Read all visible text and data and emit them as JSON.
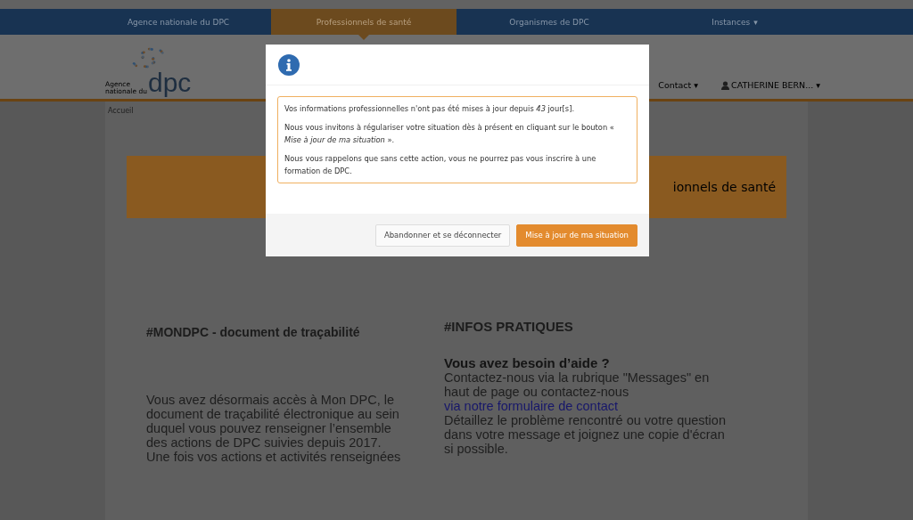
{
  "top_nav": {
    "items": [
      {
        "label": "Agence nationale du DPC",
        "selected": false
      },
      {
        "label": "Professionnels de santé",
        "selected": true
      },
      {
        "label": "Organismes de DPC",
        "selected": false
      },
      {
        "label": "Instances",
        "selected": false,
        "caret": "▾"
      }
    ]
  },
  "header": {
    "logo": {
      "subtitle": "Agence nationale du",
      "wordmark": "dpc"
    },
    "contact": "Contact",
    "contact_caret": "▾",
    "user": "CATHERINE BERN...",
    "user_caret": "▾"
  },
  "breadcrumb": "Accueil",
  "banner": {
    "text": "ionnels de santé"
  },
  "left_column": {
    "heading": "#MONDPC - document de traçabilité",
    "paragraph": "Vous avez désormais accès à Mon DPC, le document de traçabilité électronique au sein duquel vous pouvez renseigner l’ensemble des actions de DPC suivies depuis 2017.",
    "cut_line": "Une fois vos actions et activités renseignées"
  },
  "right_column": {
    "heading": "#INFOS PRATIQUES",
    "subheading": "Vous avez besoin d’aide ?",
    "text_before_link": "Contactez-nous via la rubrique \"Messages\" en haut de page ou contactez-nous ",
    "link": "via notre formulaire de contact",
    "text_after_link": "Détaillez le problème rencontré ou votre question dans votre message et joignez une copie d'écran si possible."
  },
  "modal": {
    "paragraphs": [
      "Vos informations professionnelles n'ont pas été mises à jour depuis *43* jour[s].",
      "Nous vous invitons à régulariser votre situation dès à présent en cliquant sur le bouton « *Mise à jour de ma situation* ».",
      "Nous vous rappelons que sans cette action, vous ne pourrez pas vous inscrire à une formation de DPC."
    ],
    "buttons": [
      {
        "label": "Abandonner et se déconnecter",
        "kind": "secondary"
      },
      {
        "label": "Mise à jour de ma situation",
        "kind": "primary"
      }
    ]
  }
}
